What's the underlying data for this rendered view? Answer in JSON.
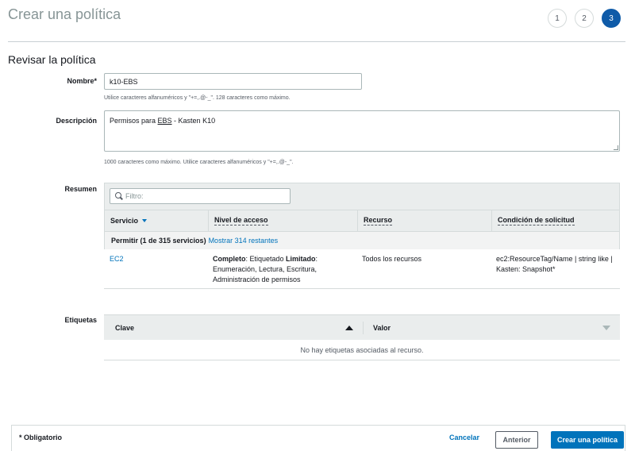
{
  "page": {
    "title": "Crear una política",
    "steps": [
      "1",
      "2",
      "3"
    ],
    "active_step": "3"
  },
  "review": {
    "section_title": "Revisar la política",
    "name_label": "Nombre*",
    "name_value": "k10-EBS",
    "name_hint": "Utilice caracteres alfanuméricos y \"+=,.@-_\". 128 caracteres como máximo.",
    "description_label": "Descripción",
    "description_prefix": "Permisos para ",
    "description_underlined": "EBS",
    "description_suffix": " - Kasten K10",
    "description_hint": "1000 caracteres como máximo. Utilice caracteres alfanuméricos y \"+=,.@-_\"."
  },
  "summary": {
    "label": "Resumen",
    "filter_placeholder": "Filtro:",
    "columns": {
      "service": "Servicio",
      "access_level": "Nivel de acceso",
      "resource": "Recurso",
      "condition": "Condición de solicitud"
    },
    "group": {
      "title": "Permitir (1 de 315 servicios)",
      "show_link": "Mostrar 314 restantes"
    },
    "rows": [
      {
        "service": "EC2",
        "access_bold1": "Completo",
        "access_text1": ": Etiquetado ",
        "access_bold2": "Limitado",
        "access_text2": ": Enumeración, Lectura, Escritura, Administración de permisos",
        "resource": "Todos los recursos",
        "condition": "ec2:ResourceTag/Name | string like | Kasten: Snapshot*"
      }
    ]
  },
  "tags": {
    "label": "Etiquetas",
    "key_header": "Clave",
    "value_header": "Valor",
    "empty_message": "No hay etiquetas asociadas al recurso."
  },
  "footer": {
    "required_note": "* Obligatorio",
    "cancel": "Cancelar",
    "previous": "Anterior",
    "create": "Crear una política"
  }
}
